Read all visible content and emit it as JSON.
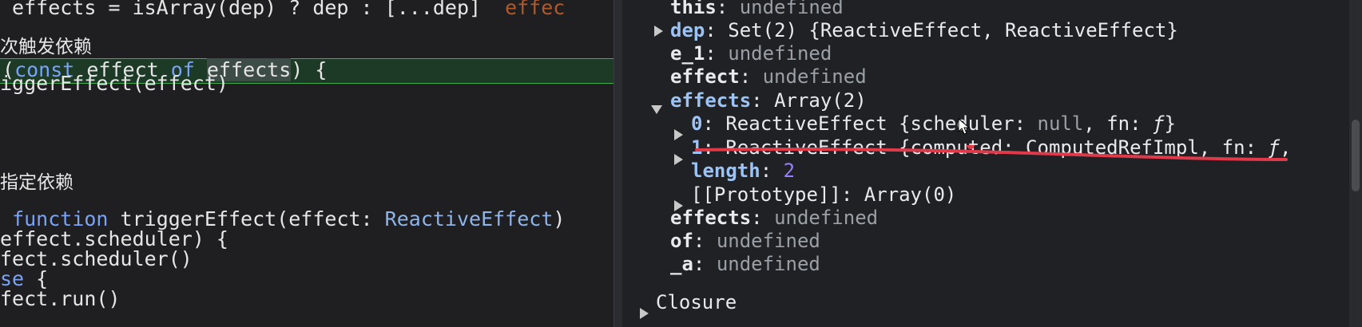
{
  "editor": {
    "line1_a": " effects = isArray(dep) ? dep : [...dep]",
    "line1_hint": "effec",
    "comment1": "次触发依赖",
    "line3_kw1": "const",
    "line3_sp1": " effect ",
    "line3_kw2": "of",
    "line3_sp2": " ",
    "line3_sel": "effects",
    "line3_end": ") {",
    "line4": "iggerEffect(effect)",
    "comment2": "指定依赖",
    "line6_kw": "function",
    "line6_mid": " triggerEffect(effect: ",
    "line6_type": "ReactiveEffect",
    "line6_end": ") ",
    "line7": "effect.scheduler) {",
    "line8": "fect.scheduler()",
    "line9_kw": "se",
    "line9_end": " {",
    "line10": "fect.run()"
  },
  "scope": {
    "this_key": "this",
    "this_val": "undefined",
    "dep_key": "dep",
    "dep_val": "Set(2) {ReactiveEffect, ReactiveEffect}",
    "e1_key": "e_1",
    "e1_val": "undefined",
    "effect_key": "effect",
    "effect_val": "undefined",
    "effects_key": "effects",
    "effects_val": "Array(2)",
    "item0_key": "0",
    "item0_val_a": "ReactiveEffect {scheduler: ",
    "item0_null": "null",
    "item0_val_b": ", fn: ",
    "item0_f": "ƒ",
    "item0_val_c": "}",
    "item1_key": "1",
    "item1_val_a": "ReactiveEffect {computed: ComputedRefImpl, fn: ",
    "item1_f": "ƒ",
    "item1_val_c": ",",
    "length_key": "length",
    "length_val": "2",
    "proto_key": "[[Prototype]]",
    "proto_val": "Array(0)",
    "effects2_key": "effects",
    "effects2_val": "undefined",
    "of_key": "of",
    "of_val": "undefined",
    "a_key": "_a",
    "a_val": "undefined",
    "closure_label": "Closure"
  },
  "colors": {
    "background": "#202124",
    "key": "#9cc3f5",
    "number": "#9980ff",
    "highlight_border": "#3fae52",
    "annotation": "#e0394a"
  }
}
